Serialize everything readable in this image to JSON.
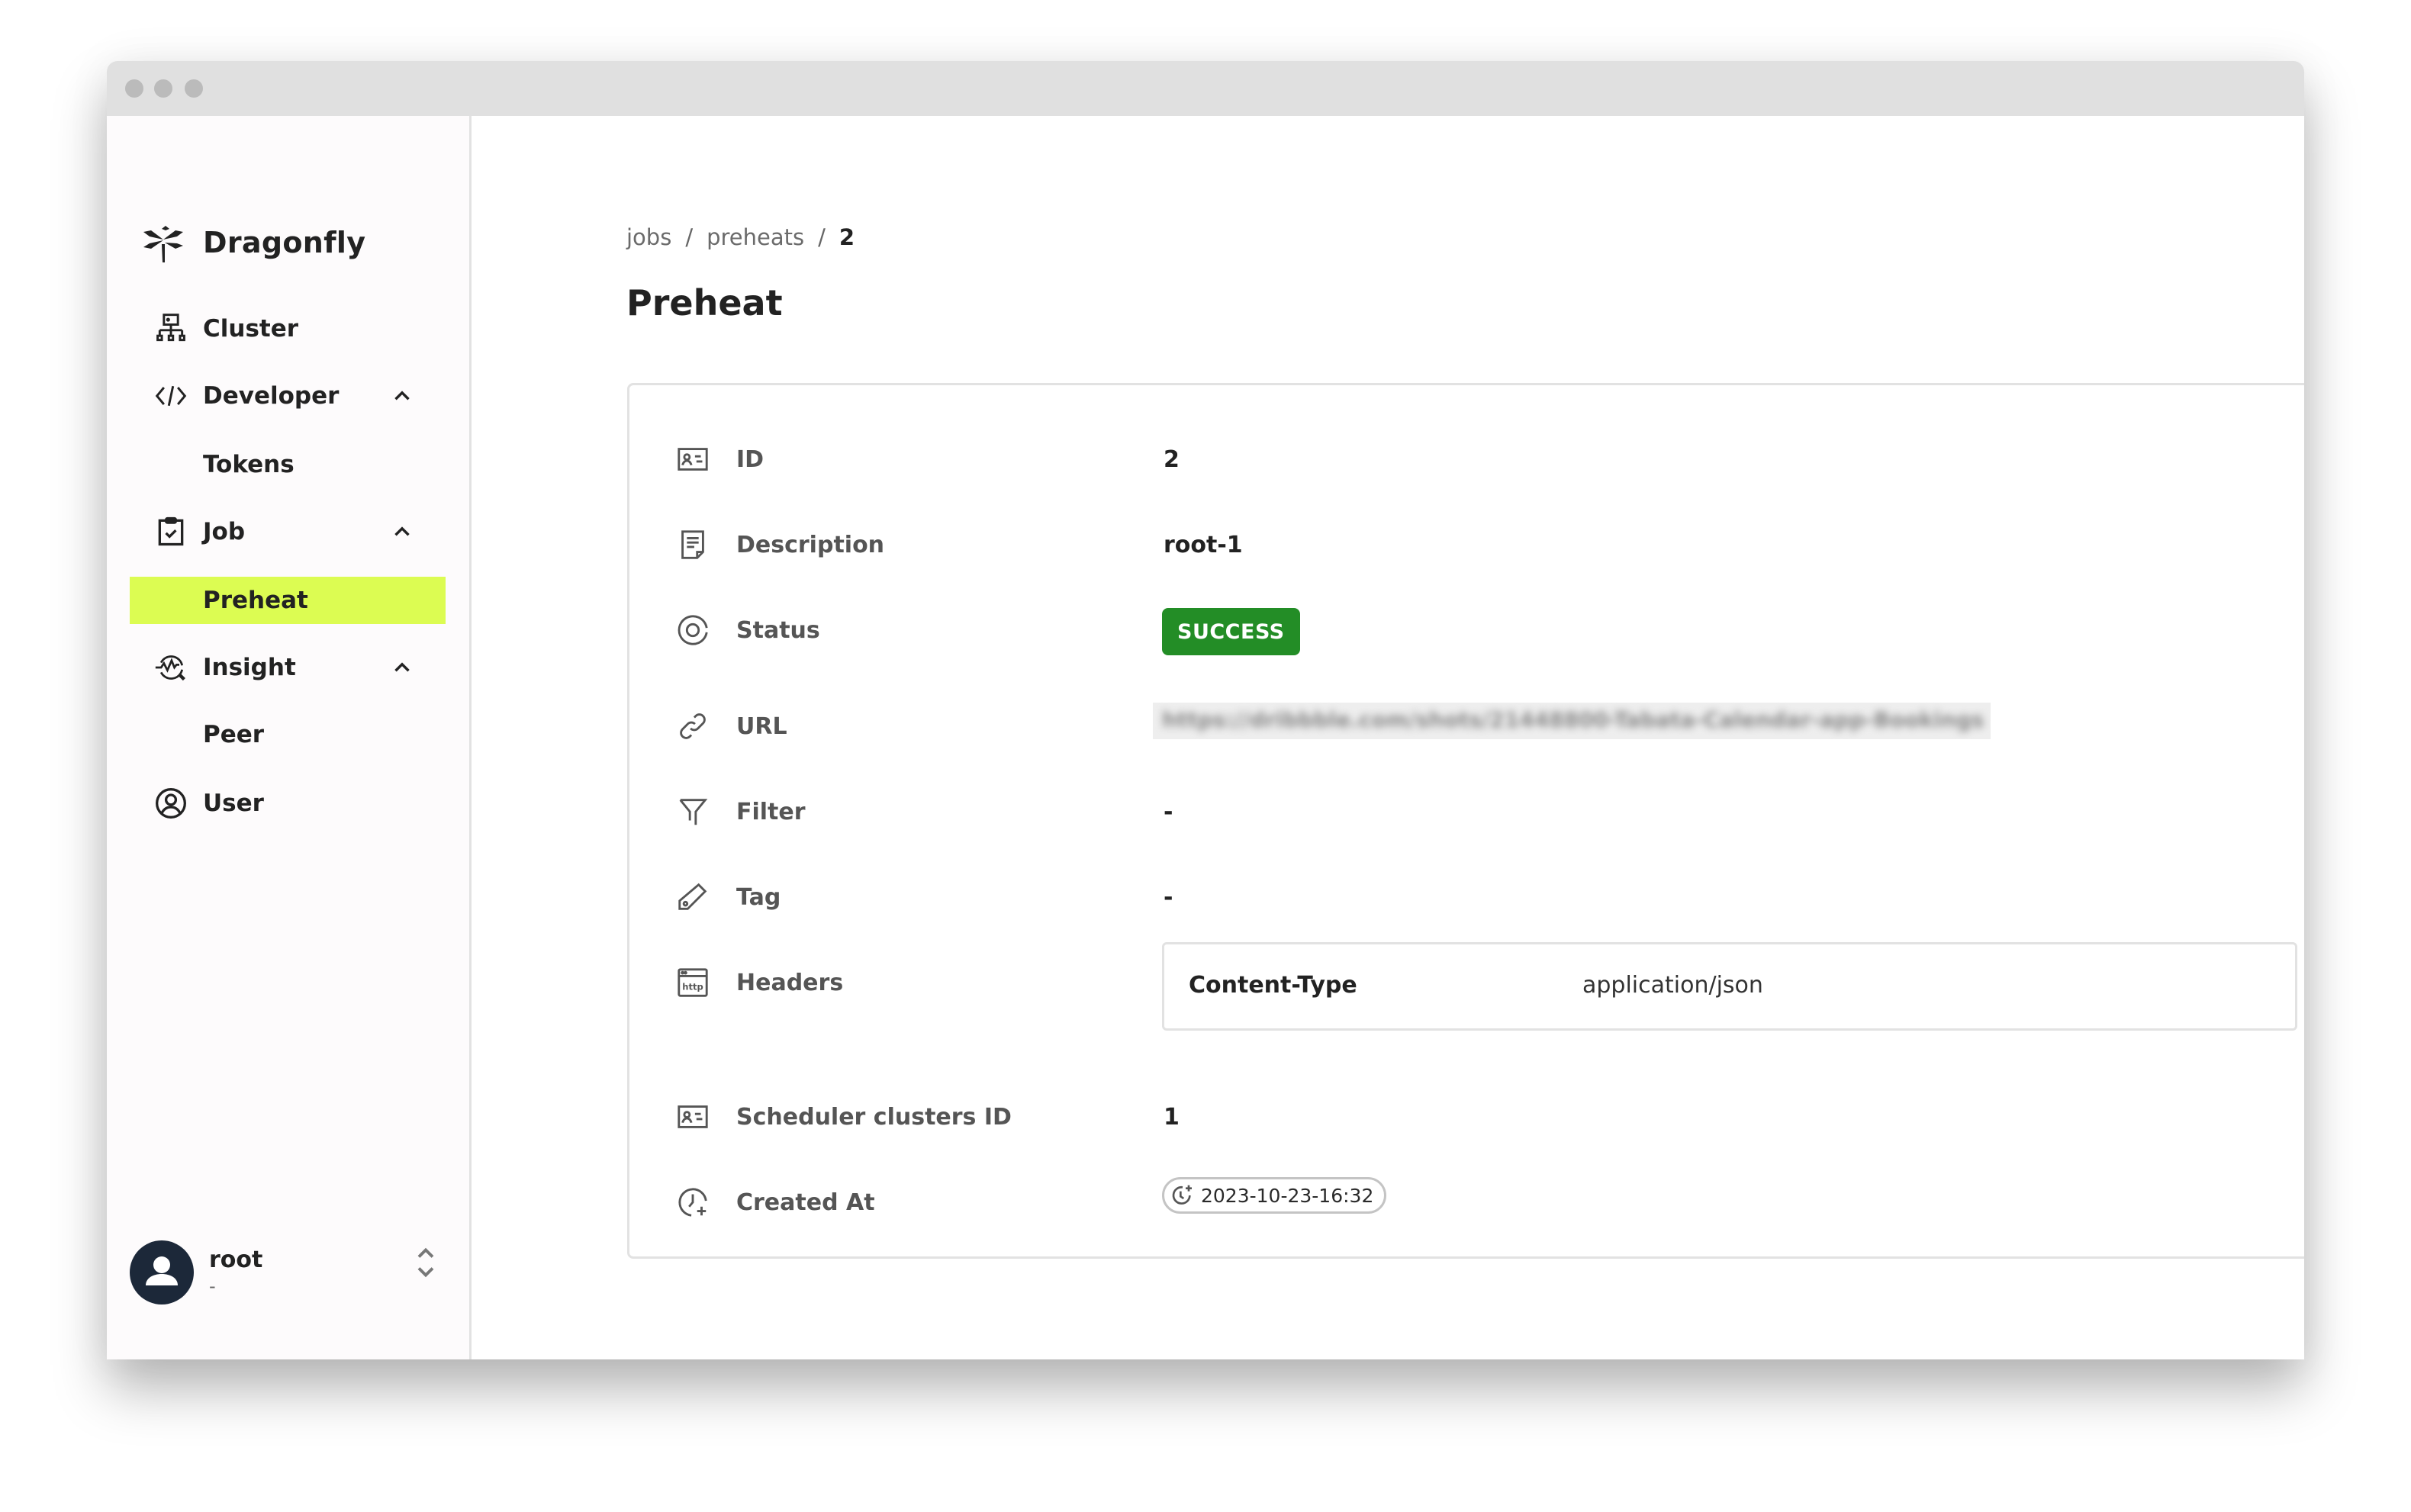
{
  "app": {
    "name": "Dragonfly",
    "accent_color": "#dcfc52"
  },
  "sidebar": {
    "items": [
      {
        "label": "Cluster",
        "icon": "cluster-icon"
      },
      {
        "label": "Developer",
        "icon": "code-icon",
        "expanded": true
      },
      {
        "label": "Tokens",
        "sub": true
      },
      {
        "label": "Job",
        "icon": "clipboard-check-icon",
        "expanded": true
      },
      {
        "label": "Preheat",
        "sub": true,
        "active": true
      },
      {
        "label": "Insight",
        "icon": "insight-icon",
        "expanded": true
      },
      {
        "label": "Peer",
        "sub": true
      },
      {
        "label": "User",
        "icon": "user-circle-icon"
      }
    ],
    "user": {
      "name": "root",
      "subtitle": "-"
    }
  },
  "breadcrumb": {
    "items": [
      "jobs",
      "preheats",
      "2"
    ],
    "separator": "/"
  },
  "page": {
    "title": "Preheat"
  },
  "details": {
    "id": {
      "label": "ID",
      "value": "2",
      "icon": "id-card-icon"
    },
    "description": {
      "label": "Description",
      "value": "root-1",
      "icon": "document-icon"
    },
    "status": {
      "label": "Status",
      "value": "SUCCESS",
      "color": "#238d26",
      "icon": "status-ring-icon"
    },
    "url": {
      "label": "URL",
      "value": "https://dribbble.com/shots/21448800-Tabata-Calendar-app-Bookings",
      "blurred": true,
      "icon": "link-icon"
    },
    "filter": {
      "label": "Filter",
      "value": "-",
      "icon": "filter-icon"
    },
    "tag": {
      "label": "Tag",
      "value": "-",
      "icon": "tag-icon"
    },
    "headers": {
      "label": "Headers",
      "icon": "http-icon",
      "entries": [
        {
          "key": "Content-Type",
          "value": "application/json"
        }
      ]
    },
    "scheduler_clusters_id": {
      "label": "Scheduler clusters ID",
      "value": "1",
      "icon": "id-card-icon"
    },
    "created_at": {
      "label": "Created At",
      "value": "2023-10-23-16:32",
      "icon": "clock-plus-icon"
    }
  }
}
